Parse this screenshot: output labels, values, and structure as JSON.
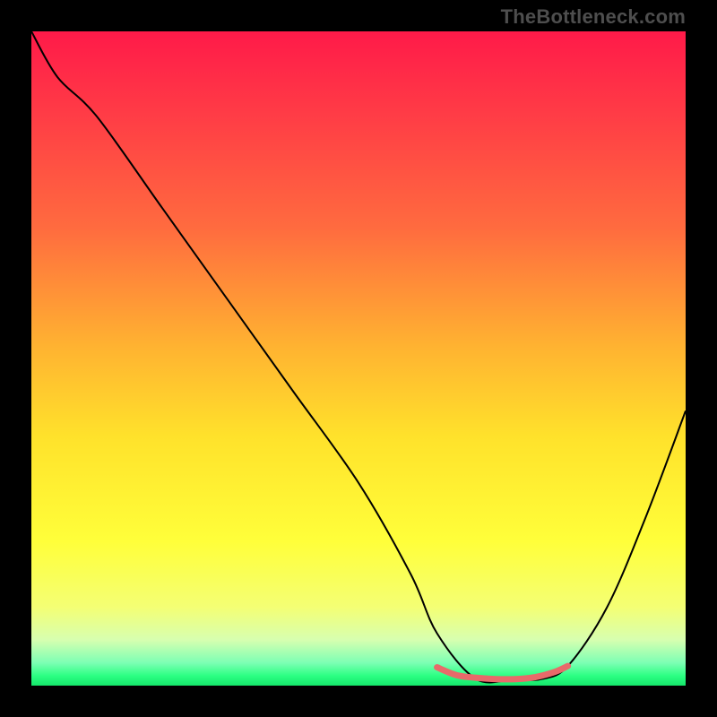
{
  "watermark": "TheBottleneck.com",
  "chart_data": {
    "type": "line",
    "title": "",
    "xlabel": "",
    "ylabel": "",
    "xlim": [
      0,
      100
    ],
    "ylim": [
      0,
      100
    ],
    "grid": false,
    "legend": false,
    "series": [
      {
        "name": "bottleneck-curve",
        "color": "#000000",
        "x": [
          0,
          4,
          10,
          20,
          30,
          40,
          50,
          58,
          62,
          68,
          74,
          78,
          82,
          88,
          94,
          100
        ],
        "y": [
          100,
          93,
          87,
          73,
          59,
          45,
          31,
          17,
          8,
          1,
          1,
          1,
          3,
          12,
          26,
          42
        ]
      },
      {
        "name": "optimal-range-highlight",
        "color": "#e86a6a",
        "x": [
          62,
          65,
          68,
          71,
          74,
          77,
          80,
          82
        ],
        "y": [
          2.8,
          1.6,
          1.2,
          1.0,
          1.0,
          1.3,
          2.1,
          3.0
        ]
      }
    ],
    "gradient_stops": [
      {
        "offset": 0.0,
        "color": "#ff1a49"
      },
      {
        "offset": 0.12,
        "color": "#ff3a46"
      },
      {
        "offset": 0.3,
        "color": "#ff6b3f"
      },
      {
        "offset": 0.48,
        "color": "#ffb231"
      },
      {
        "offset": 0.62,
        "color": "#ffe22b"
      },
      {
        "offset": 0.78,
        "color": "#ffff3a"
      },
      {
        "offset": 0.88,
        "color": "#f4ff74"
      },
      {
        "offset": 0.93,
        "color": "#d7ffb0"
      },
      {
        "offset": 0.965,
        "color": "#7dffb4"
      },
      {
        "offset": 0.985,
        "color": "#2cff83"
      },
      {
        "offset": 1.0,
        "color": "#14e66a"
      }
    ],
    "optimal_range": {
      "start": 62,
      "end": 82
    }
  }
}
